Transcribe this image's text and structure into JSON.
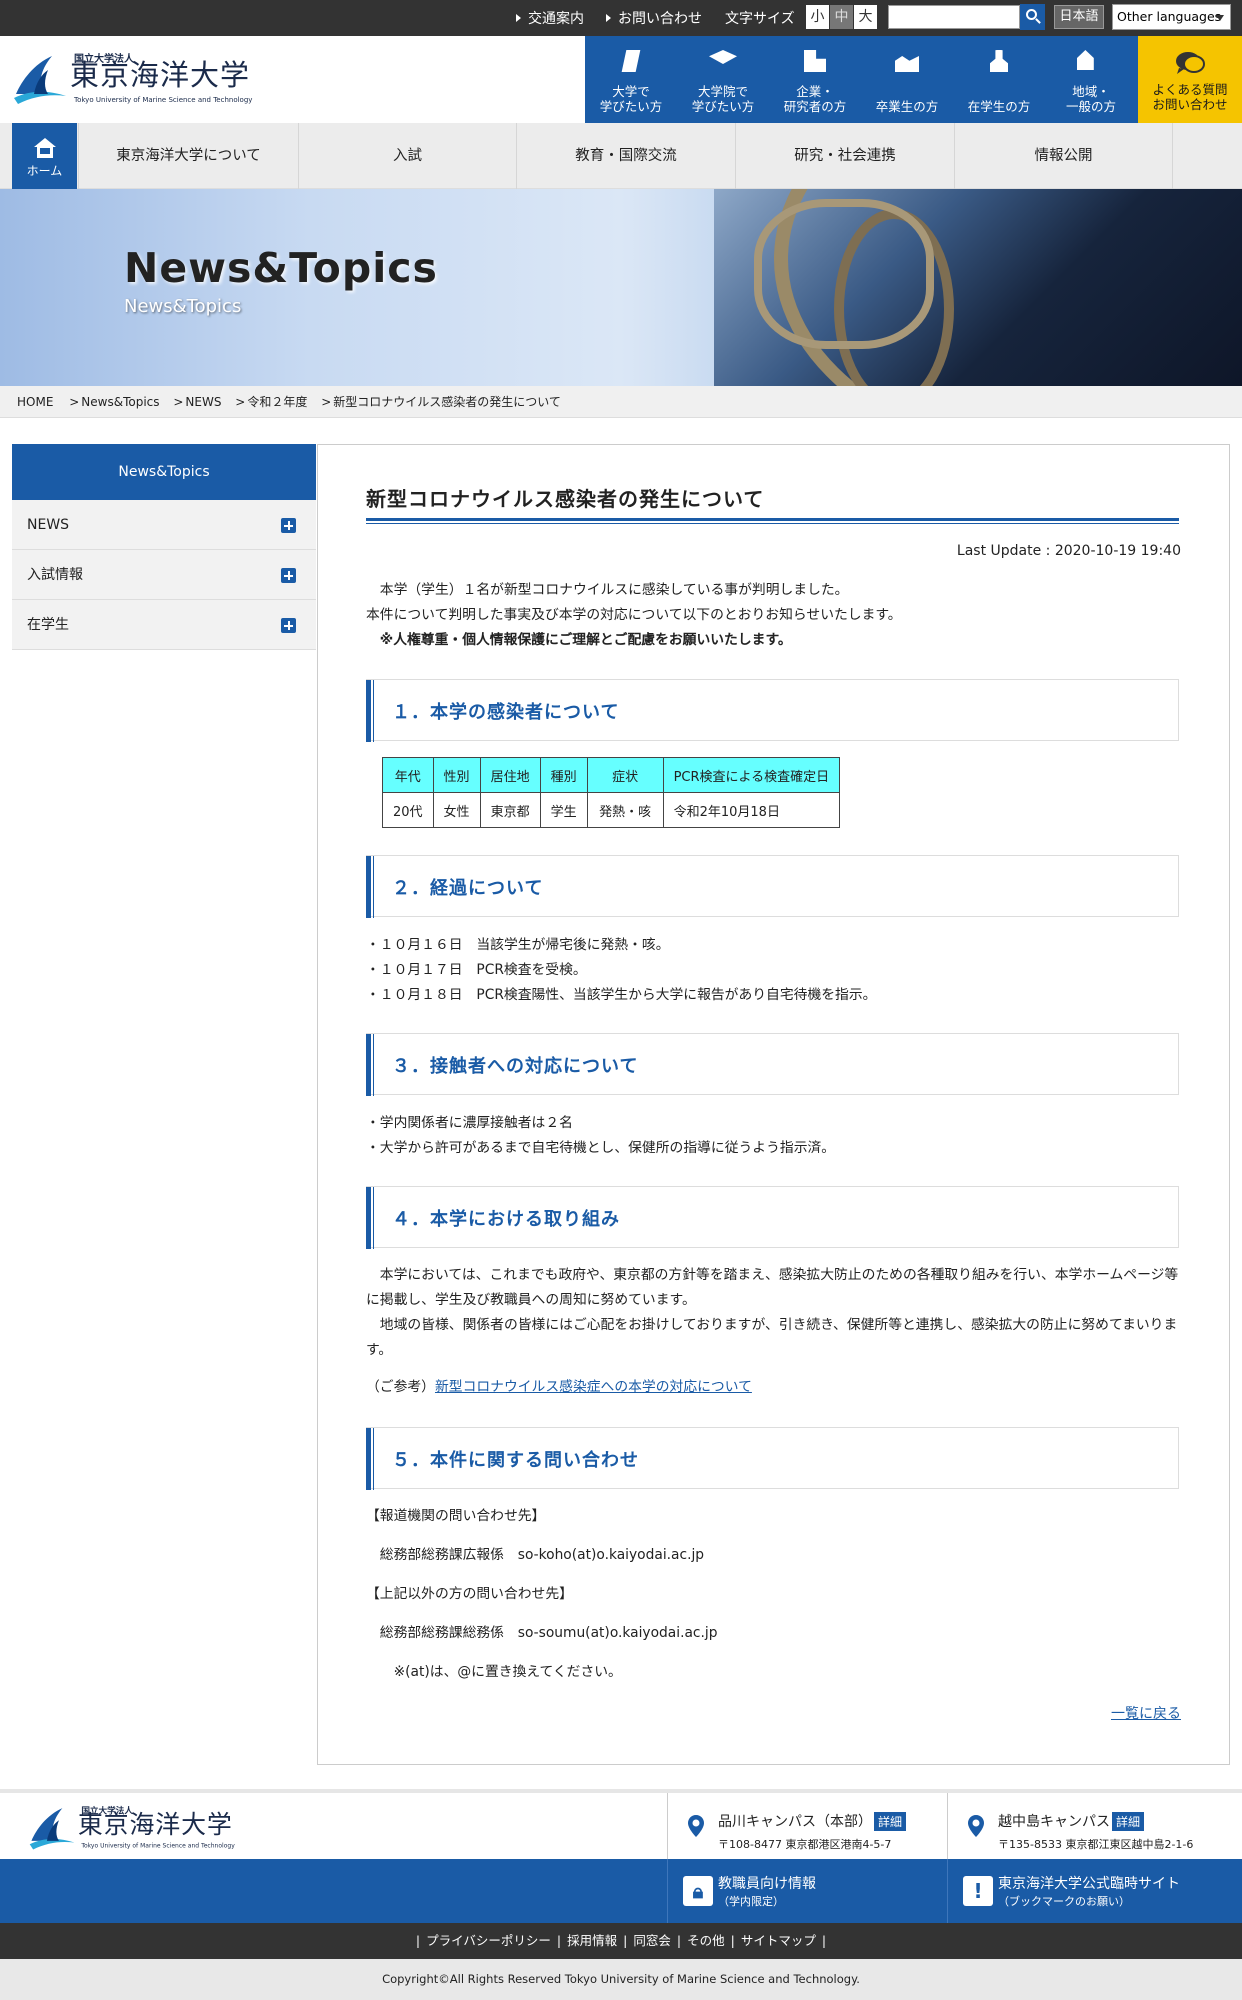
{
  "topbar": {
    "links": [
      "交通案内",
      "お問い合わせ"
    ],
    "font_size_label": "文字サイズ",
    "font_sizes": [
      "小",
      "中",
      "大"
    ],
    "search_placeholder": "",
    "lang_ja": "日本語",
    "lang_other": "Other languages"
  },
  "logo": {
    "corp": "国立大学法人",
    "name": "東京海洋大学",
    "en": "Tokyo University of Marine Science and Technology"
  },
  "audience_nav": [
    {
      "line1": "大学で",
      "line2": "学びたい方"
    },
    {
      "line1": "大学院で",
      "line2": "学びたい方"
    },
    {
      "line1": "企業・",
      "line2": "研究者の方"
    },
    {
      "line1": "",
      "line2": "卒業生の方"
    },
    {
      "line1": "",
      "line2": "在学生の方"
    },
    {
      "line1": "地域・",
      "line2": "一般の方"
    },
    {
      "line1": "よくある質問",
      "line2": "お問い合わせ"
    }
  ],
  "main_nav": {
    "home": "ホーム",
    "items": [
      "東京海洋大学について",
      "入試",
      "教育・国際交流",
      "研究・社会連携",
      "情報公開"
    ]
  },
  "hero": {
    "title": "News&Topics",
    "subtitle": "News&Topics"
  },
  "breadcrumb": [
    "HOME",
    "News&Topics",
    "NEWS",
    "令和２年度",
    "新型コロナウイルス感染者の発生について"
  ],
  "sidebar": {
    "heading": "News&Topics",
    "items": [
      {
        "label": "NEWS"
      },
      {
        "label": "入試情報"
      },
      {
        "label": "在学生"
      }
    ]
  },
  "article": {
    "title": "新型コロナウイルス感染者の発生について",
    "last_update": "Last Update : 2020-10-19 19:40",
    "intro1": "　本学（学生）１名が新型コロナウイルスに感染している事が判明しました。",
    "intro2": "本件について判明した事実及び本学の対応について以下のとおりお知らせいたします。",
    "intro3": "　※人権尊重・個人情報保護にご理解とご配慮をお願いいたします。",
    "sec1": "１．本学の感染者について",
    "table": {
      "headers": [
        "年代",
        "性別",
        "居住地",
        "種別",
        "症状",
        "PCR検査による検査確定日"
      ],
      "row": [
        "20代",
        "女性",
        "東京都",
        "学生",
        "発熱・咳",
        "令和2年10月18日"
      ]
    },
    "sec2": "２．経過について",
    "timeline": [
      "・１０月１６日　当該学生が帰宅後に発熱・咳。",
      "・１０月１７日　PCR検査を受検。",
      "・１０月１８日　PCR検査陽性、当該学生から大学に報告があり自宅待機を指示。"
    ],
    "sec3": "３．接触者への対応について",
    "contacts": [
      "・学内関係者に濃厚接触者は２名",
      "・大学から許可があるまで自宅待機とし、保健所の指導に従うよう指示済。"
    ],
    "sec4": "４．本学における取り組み",
    "efforts1": "　本学においては、これまでも政府や、東京都の方針等を踏まえ、感染拡大防止のための各種取り組みを行い、本学ホームページ等に掲載し、学生及び教職員への周知に努めています。",
    "efforts2": "　地域の皆様、関係者の皆様にはご心配をお掛けしておりますが、引き続き、保健所等と連携し、感染拡大の防止に努めてまいります。",
    "ref_prefix": "（ご参考）",
    "ref_link": "新型コロナウイルス感染症への本学の対応について",
    "sec5": "５．本件に関する問い合わせ",
    "press_head": "【報道機関の問い合わせ先】",
    "press_contact": "　総務部総務課広報係　so-koho(at)o.kaiyodai.ac.jp",
    "other_head": "【上記以外の方の問い合わせ先】",
    "other_contact": "　総務部総務課総務係　so-soumu(at)o.kaiyodai.ac.jp",
    "note": "　　※(at)は、@に置き換えてください。",
    "back": "一覧に戻る"
  },
  "footer": {
    "campuses": [
      {
        "name": "品川キャンパス（本部）",
        "detail": "詳細",
        "address": "〒108-8477 東京都港区港南4-5-7"
      },
      {
        "name": "越中島キャンパス",
        "detail": "詳細",
        "address": "〒135-8533 東京都江東区越中島2-1-6"
      }
    ],
    "blue_links": [
      {
        "l1": "教職員向け情報",
        "l2": "（学内限定）"
      },
      {
        "l1": "東京海洋大学公式臨時サイト",
        "l2": "（ブックマークのお願い）"
      }
    ],
    "links": [
      "プライバシーポリシー",
      "採用情報",
      "同窓会",
      "その他",
      "サイトマップ"
    ],
    "copyright": "Copyright©All Rights Reserved Tokyo University of Marine Science and Technology."
  },
  "colors": {
    "primary": "#1a5ba6",
    "faq": "#f5c400",
    "table_header": "#66ffff",
    "topbar": "#333333"
  }
}
